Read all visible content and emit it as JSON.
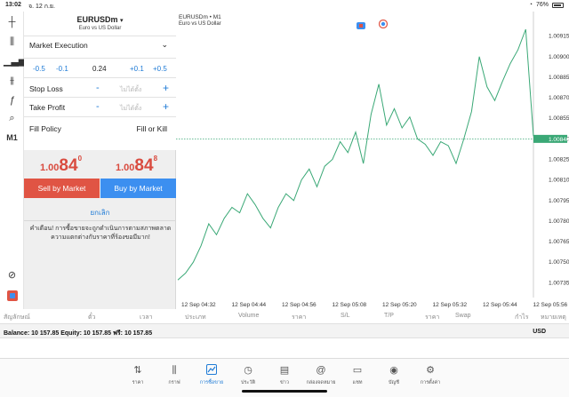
{
  "status_bar": {
    "time": "13:02",
    "date": "จ. 12 ก.ย.",
    "battery": "76%"
  },
  "left_tools": {
    "timeframe": "M1"
  },
  "trade_panel": {
    "symbol": "EURUSDm",
    "symbol_description": "Euro vs US Dollar",
    "order_type": "Market Execution",
    "volume_steps": {
      "minus_big": "-0.5",
      "minus_small": "-0.1",
      "volume": "0.24",
      "plus_small": "+0.1",
      "plus_big": "+0.5"
    },
    "stop_loss": {
      "label": "Stop Loss",
      "minus": "-",
      "placeholder": "ไม่ได้ตั้ง",
      "plus": "+"
    },
    "take_profit": {
      "label": "Take Profit",
      "minus": "-",
      "placeholder": "ไม่ได้ตั้ง",
      "plus": "+"
    },
    "fill_policy": {
      "label": "Fill Policy",
      "value": "Fill or Kill"
    },
    "bid": {
      "small": "1.00",
      "big": "84",
      "sup": "0"
    },
    "ask": {
      "small": "1.00",
      "big": "84",
      "sup": "8"
    },
    "sell_label": "Sell by Market",
    "buy_label": "Buy by Market",
    "cancel_label": "ยกเลิก",
    "warning": "คำเตือน! การซื้อขายจะถูกดำเนินการตามสภาพตลาด ความแตกต่างกับราคาที่ร้องขอมีมาก!"
  },
  "chart": {
    "title": "EURUSDm • M1",
    "subtitle": "Euro vs US Dollar",
    "current_price_label": "1.00840",
    "colors": {
      "line": "#3aa876",
      "price_line": "#3aa876",
      "sell": "#e05444",
      "buy": "#3c8ff0"
    }
  },
  "chart_data": {
    "type": "line",
    "title": "EURUSDm • M1",
    "y_ticks": [
      "1.00915",
      "1.00900",
      "1.00885",
      "1.00870",
      "1.00855",
      "1.00840",
      "1.00825",
      "1.00810",
      "1.00795",
      "1.00780",
      "1.00765",
      "1.00750",
      "1.00735"
    ],
    "x_ticks": [
      "12 Sep 04:32",
      "12 Sep 04:44",
      "12 Sep 04:56",
      "12 Sep 05:08",
      "12 Sep 05:20",
      "12 Sep 05:32",
      "12 Sep 05:44",
      "12 Sep 05:56"
    ],
    "ylim": [
      1.0073,
      1.0092
    ],
    "x": [
      0,
      2,
      4,
      6,
      8,
      10,
      12,
      14,
      16,
      18,
      20,
      22,
      24,
      26,
      28,
      30,
      32,
      34,
      36,
      38,
      40,
      42,
      44,
      46,
      48,
      50,
      52,
      54,
      56,
      58,
      60,
      62,
      64,
      66,
      68,
      70,
      72,
      74,
      76,
      78,
      80,
      82,
      84,
      86,
      88
    ],
    "values": [
      1.00737,
      1.00742,
      1.0075,
      1.00762,
      1.00778,
      1.0077,
      1.00782,
      1.0079,
      1.00786,
      1.008,
      1.00792,
      1.00782,
      1.00775,
      1.0079,
      1.008,
      1.00795,
      1.0081,
      1.00818,
      1.00805,
      1.0082,
      1.00825,
      1.00838,
      1.0083,
      1.00845,
      1.00822,
      1.00858,
      1.0088,
      1.0085,
      1.00862,
      1.00848,
      1.00856,
      1.0084,
      1.00836,
      1.00828,
      1.00838,
      1.00835,
      1.00822,
      1.0084,
      1.0086,
      1.009,
      1.00878,
      1.00868,
      1.00882,
      1.00895,
      1.00905,
      1.0092,
      1.00842
    ],
    "current_price": 1.0084
  },
  "table_headers": [
    "สัญลักษณ์",
    "ตั๋ว",
    "เวลา",
    "ประเภท",
    "Volume",
    "ราคา",
    "S/L",
    "T/P",
    "ราคา",
    "Swap",
    "กำไร",
    "หมายเหตุ"
  ],
  "balance_bar": {
    "text": "Balance: 10 157.85 Equity: 10 157.85 ฟรี: 10 157.85",
    "currency": "USD"
  },
  "tabs": [
    {
      "label": "ราคา",
      "icon": "quotes-icon"
    },
    {
      "label": "กราฟ",
      "icon": "chart-icon"
    },
    {
      "label": "การซื้อขาย",
      "icon": "trade-icon"
    },
    {
      "label": "ประวัติ",
      "icon": "history-icon"
    },
    {
      "label": "ข่าว",
      "icon": "news-icon"
    },
    {
      "label": "กล่องจดหมาย",
      "icon": "mailbox-icon"
    },
    {
      "label": "แชท",
      "icon": "chat-icon"
    },
    {
      "label": "บัญชี",
      "icon": "account-icon"
    },
    {
      "label": "การตั้งค่า",
      "icon": "settings-icon"
    }
  ]
}
